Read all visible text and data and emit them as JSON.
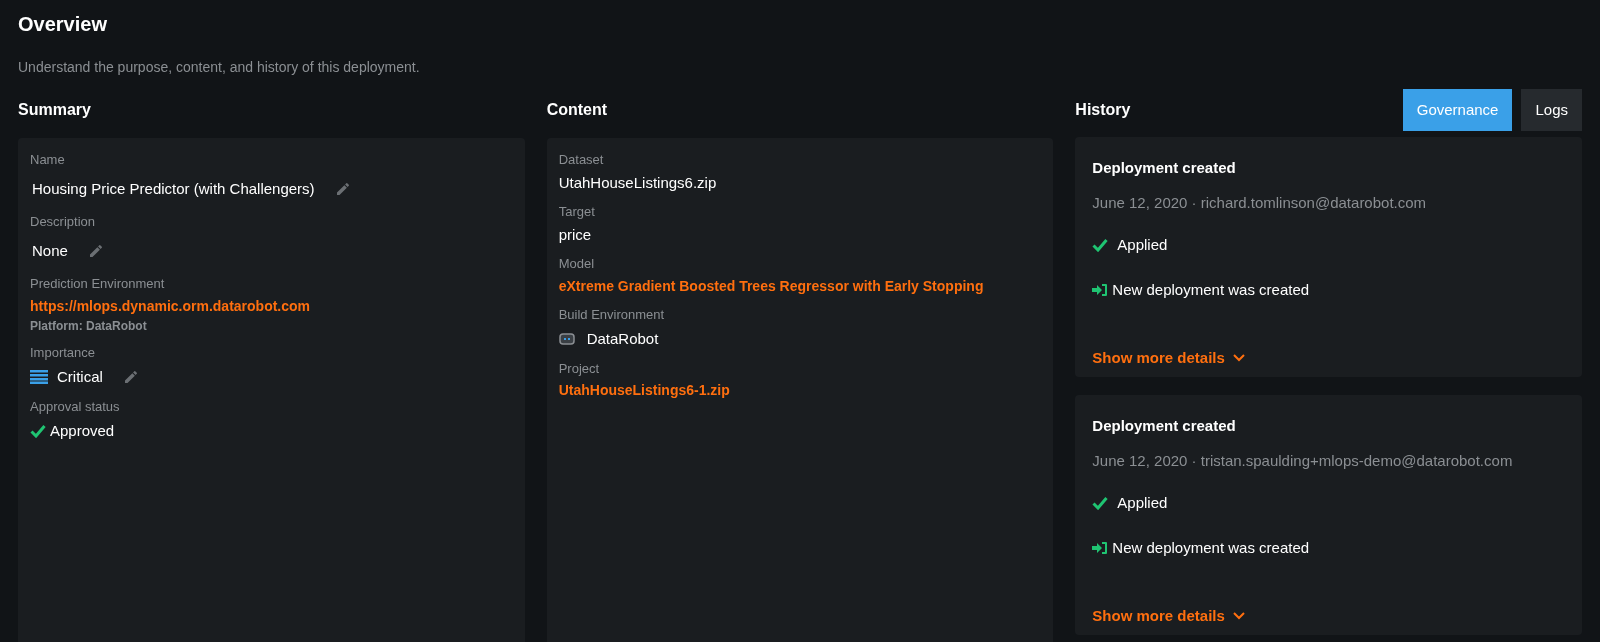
{
  "page": {
    "title": "Overview",
    "subtitle": "Understand the purpose, content, and history of this deployment."
  },
  "summary": {
    "heading": "Summary",
    "fields": [
      {
        "kind": "editable",
        "label": "Name",
        "value": "Housing Price Predictor (with Challengers)"
      },
      {
        "kind": "editable",
        "label": "Description",
        "value": "None"
      },
      {
        "kind": "link",
        "label": "Prediction Environment",
        "value": "https://mlops.dynamic.orm.datarobot.com",
        "note": "Platform: DataRobot"
      },
      {
        "kind": "importance",
        "label": "Importance",
        "value": "Critical"
      },
      {
        "kind": "status",
        "label": "Approval status",
        "value": "Approved"
      }
    ]
  },
  "content": {
    "heading": "Content",
    "fields": [
      {
        "kind": "text",
        "label": "Dataset",
        "value": "UtahHouseListings6.zip"
      },
      {
        "kind": "text",
        "label": "Target",
        "value": "price"
      },
      {
        "kind": "link",
        "label": "Model",
        "value": "eXtreme Gradient Boosted Trees Regressor with Early Stopping"
      },
      {
        "kind": "environment",
        "label": "Build Environment",
        "value": "DataRobot"
      },
      {
        "kind": "link",
        "label": "Project",
        "value": "UtahHouseListings6-1.zip"
      }
    ]
  },
  "history": {
    "heading": "History",
    "tabs": [
      {
        "label": "Governance",
        "selected": true
      },
      {
        "label": "Logs",
        "selected": false
      }
    ],
    "entries": [
      {
        "title": "Deployment created",
        "meta": "June 12, 2020 · richard.tomlinson@datarobot.com",
        "status": "Applied",
        "action": "New deployment was created",
        "toggle": "Show more details"
      },
      {
        "title": "Deployment created",
        "meta": "June 12, 2020 · tristan.spaulding+mlops-demo@datarobot.com",
        "status": "Applied",
        "action": "New deployment was created",
        "toggle": "Show more details"
      }
    ]
  }
}
